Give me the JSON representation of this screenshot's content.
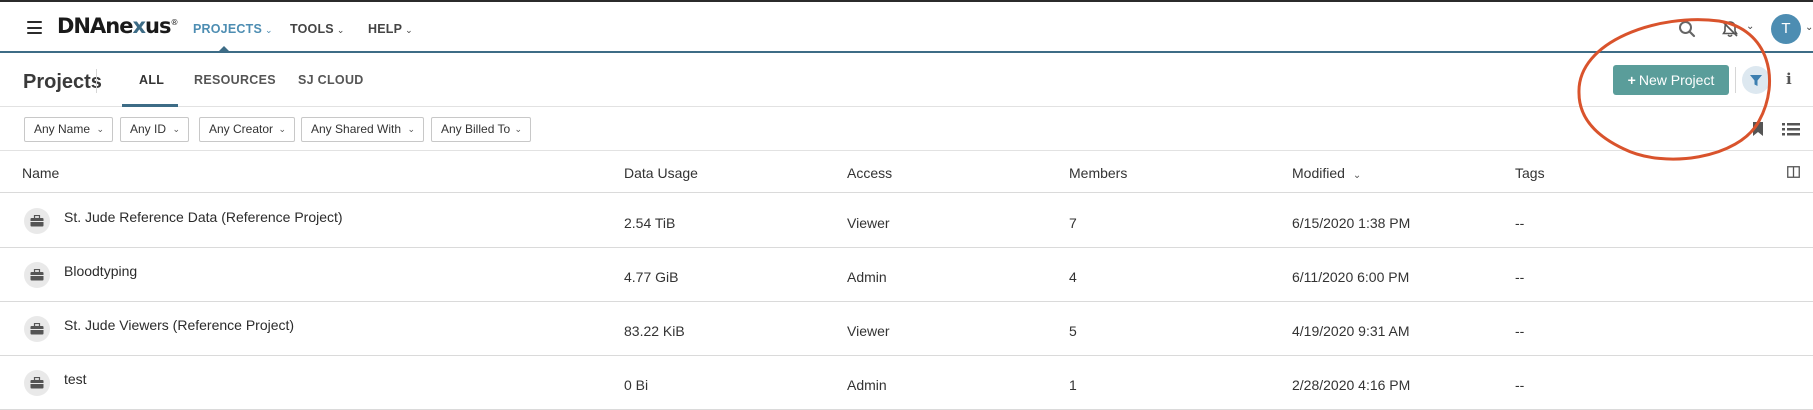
{
  "nav": {
    "logo": "DNAnexus",
    "logo_mark": "®",
    "menus": [
      {
        "label": "PROJECTS"
      },
      {
        "label": "TOOLS"
      },
      {
        "label": "HELP"
      }
    ],
    "avatar_initial": "T",
    "accent_color": "#3d6c86",
    "active_color": "#4d8db2"
  },
  "subheader": {
    "title": "Projects",
    "tabs": [
      {
        "label": "ALL",
        "active": true
      },
      {
        "label": "RESOURCES"
      },
      {
        "label": "SJ CLOUD"
      }
    ],
    "new_project_label": "New Project",
    "new_project_color": "#5a9d9a"
  },
  "filters": [
    {
      "label": "Any Name"
    },
    {
      "label": "Any ID"
    },
    {
      "label": "Any Creator"
    },
    {
      "label": "Any Shared With"
    },
    {
      "label": "Any Billed To"
    }
  ],
  "table": {
    "columns": [
      "Name",
      "Data Usage",
      "Access",
      "Members",
      "Modified",
      "Tags"
    ],
    "sorted_by": "Modified",
    "rows": [
      {
        "name": "St. Jude Reference Data (Reference Project)",
        "data_usage": "2.54 TiB",
        "access": "Viewer",
        "members": "7",
        "modified": "6/15/2020 1:38 PM",
        "tags": "--"
      },
      {
        "name": "Bloodtyping",
        "data_usage": "4.77 GiB",
        "access": "Admin",
        "members": "4",
        "modified": "6/11/2020 6:00 PM",
        "tags": "--"
      },
      {
        "name": "St. Jude Viewers (Reference Project)",
        "data_usage": "83.22 KiB",
        "access": "Viewer",
        "members": "5",
        "modified": "4/19/2020 9:31 AM",
        "tags": "--"
      },
      {
        "name": "test",
        "data_usage": "0 Bi",
        "access": "Admin",
        "members": "1",
        "modified": "2/28/2020 4:16 PM",
        "tags": "--"
      }
    ]
  },
  "annotation": {
    "color": "#d9532c",
    "target": "new-project-button"
  }
}
